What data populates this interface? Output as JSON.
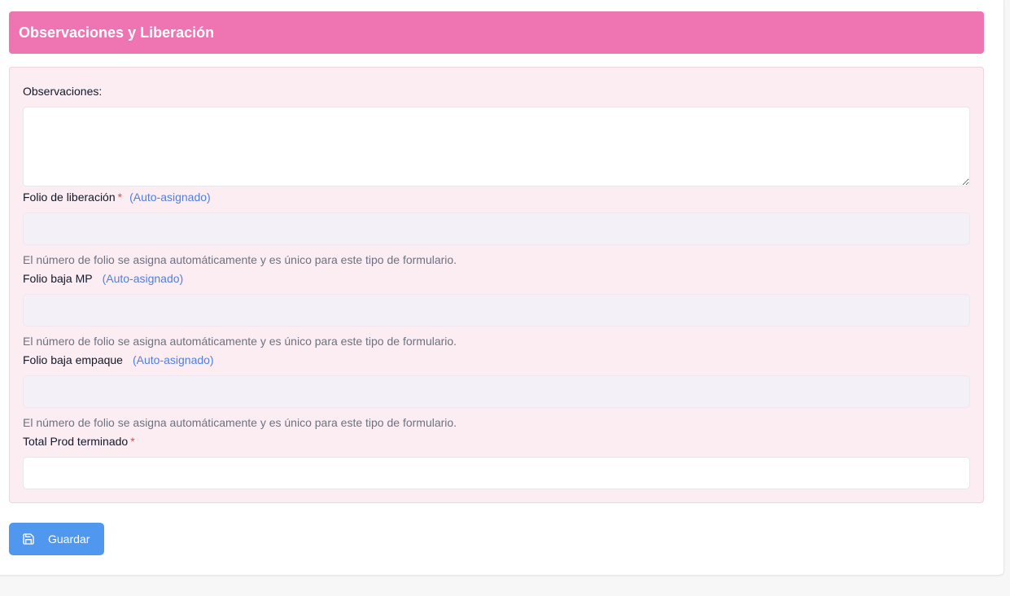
{
  "section": {
    "title": "Observaciones y Liberación"
  },
  "form": {
    "observaciones": {
      "label": "Observaciones:",
      "value": ""
    },
    "folio_liberacion": {
      "label": "Folio de liberación",
      "required_mark": "*",
      "auto_label": "(Auto-asignado)",
      "value": "",
      "help": "El número de folio se asigna automáticamente y es único para este tipo de formulario."
    },
    "folio_baja_mp": {
      "label": "Folio baja MP",
      "auto_label": "(Auto-asignado)",
      "value": "",
      "help": "El número de folio se asigna automáticamente y es único para este tipo de formulario."
    },
    "folio_baja_empaque": {
      "label": "Folio baja empaque",
      "auto_label": "(Auto-asignado)",
      "value": "",
      "help": "El número de folio se asigna automáticamente y es único para este tipo de formulario."
    },
    "total_prod_terminado": {
      "label": "Total Prod terminado",
      "required_mark": "*",
      "value": ""
    }
  },
  "actions": {
    "save_label": "Guardar"
  },
  "colors": {
    "header_bg": "#ee74b2",
    "section_bg": "#fcedf3",
    "auto_text": "#4f7fe0",
    "required": "#ef4444",
    "button_bg": "#4f97ef"
  },
  "icons": {
    "save": "save-icon"
  }
}
